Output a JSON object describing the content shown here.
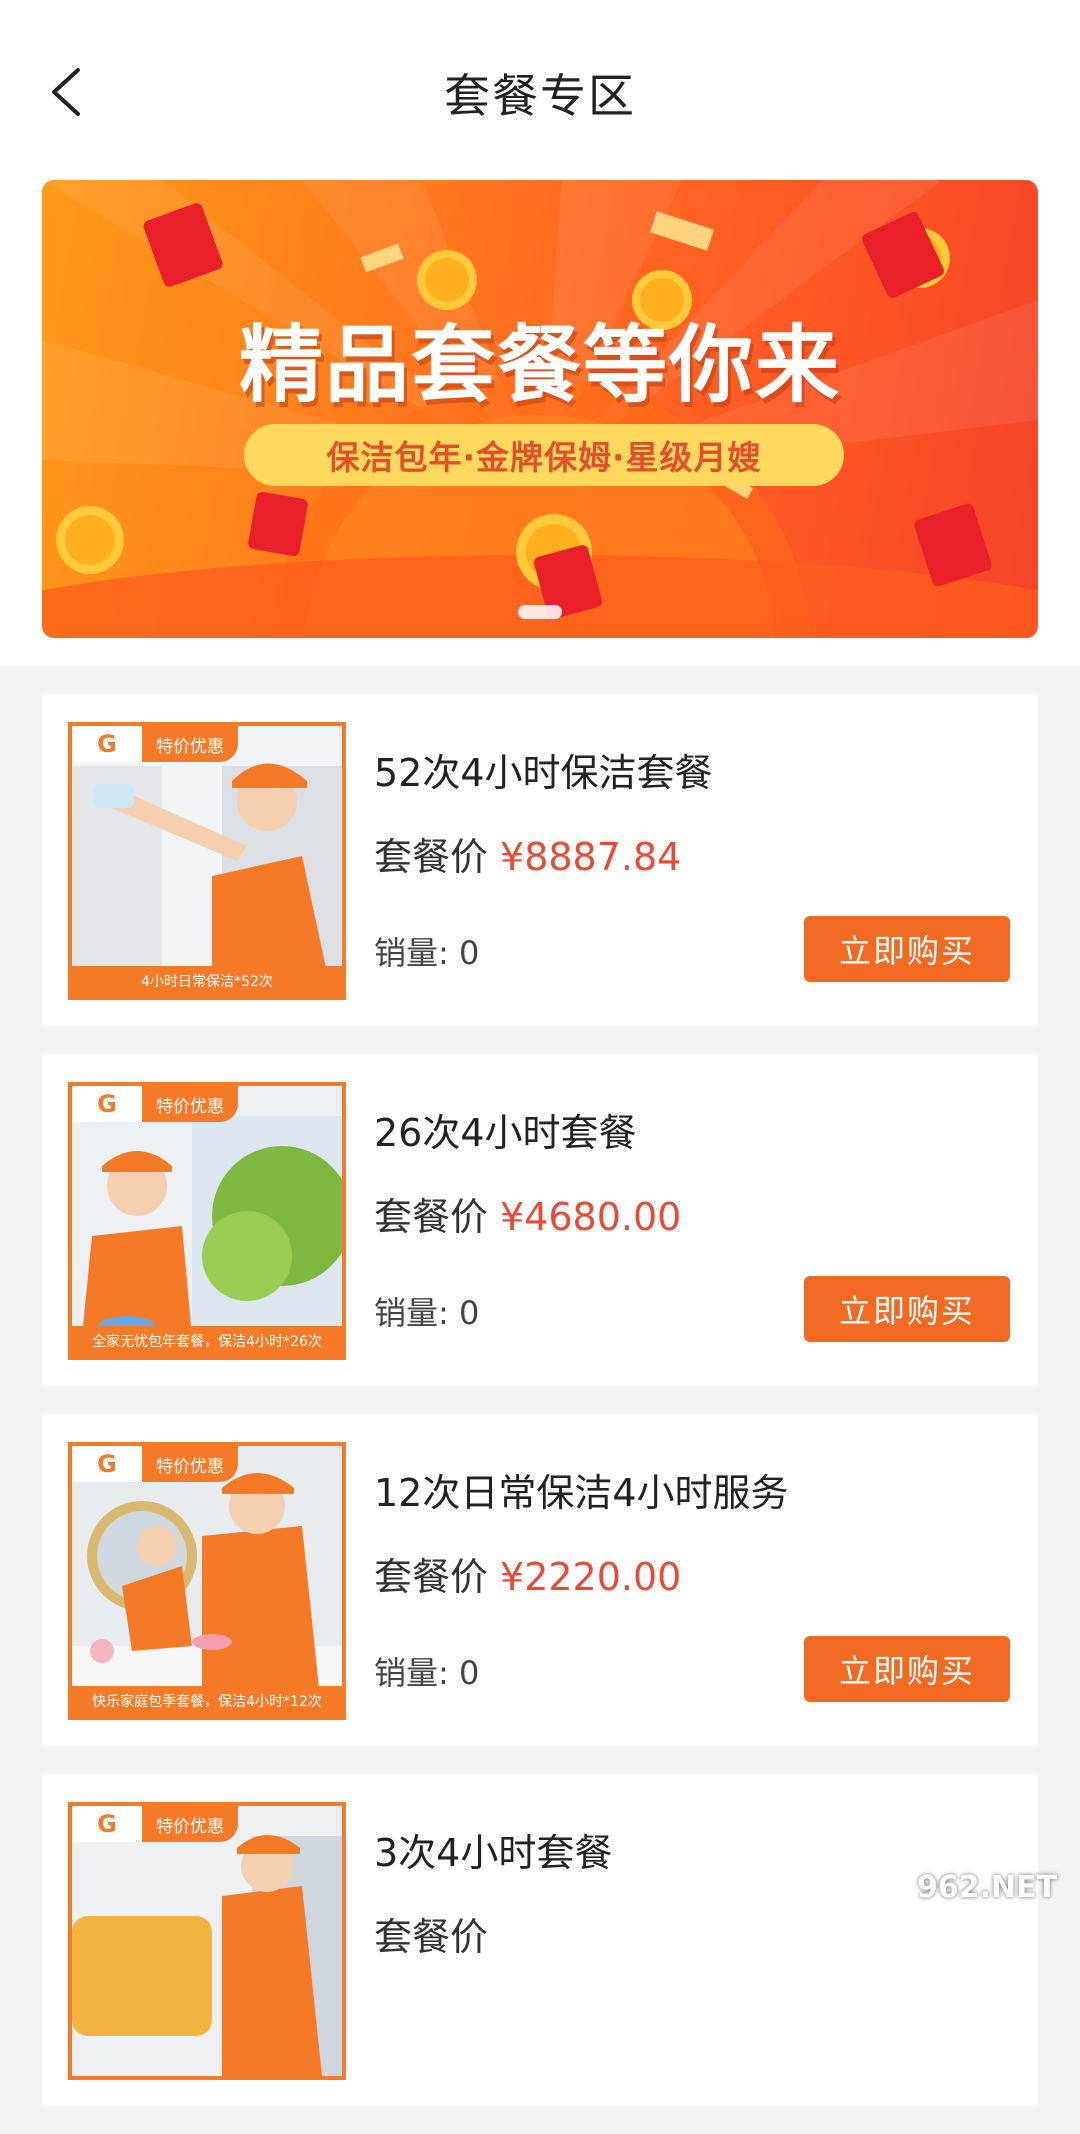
{
  "header": {
    "title": "套餐专区"
  },
  "banner": {
    "title": "精品套餐等你来",
    "subtitle": "保洁包年·金牌保姆·星级月嫂"
  },
  "packages": [
    {
      "name": "52次4小时保洁套餐",
      "price_label": "套餐价",
      "price": "¥8887.84",
      "sales": "销量: 0",
      "buy_label": "立即购买",
      "badge": "特价优惠",
      "thumb_caption": "4小时日常保洁*52次"
    },
    {
      "name": "26次4小时套餐",
      "price_label": "套餐价",
      "price": "¥4680.00",
      "sales": "销量: 0",
      "buy_label": "立即购买",
      "badge": "特价优惠",
      "thumb_caption": "全家无忧包年套餐，保洁4小时*26次"
    },
    {
      "name": "12次日常保洁4小时服务",
      "price_label": "套餐价",
      "price": "¥2220.00",
      "sales": "销量: 0",
      "buy_label": "立即购买",
      "badge": "特价优惠",
      "thumb_caption": "快乐家庭包季套餐，保洁4小时*12次"
    },
    {
      "name": "3次4小时套餐",
      "price_label": "套餐价",
      "price": "",
      "sales": "",
      "buy_label": "",
      "badge": "特价优惠",
      "thumb_caption": ""
    }
  ],
  "watermark": "962.NET",
  "colors": {
    "accent": "#f06a23",
    "price": "#e84a35",
    "banner_start": "#ff9a1a",
    "banner_end": "#f5442a"
  }
}
